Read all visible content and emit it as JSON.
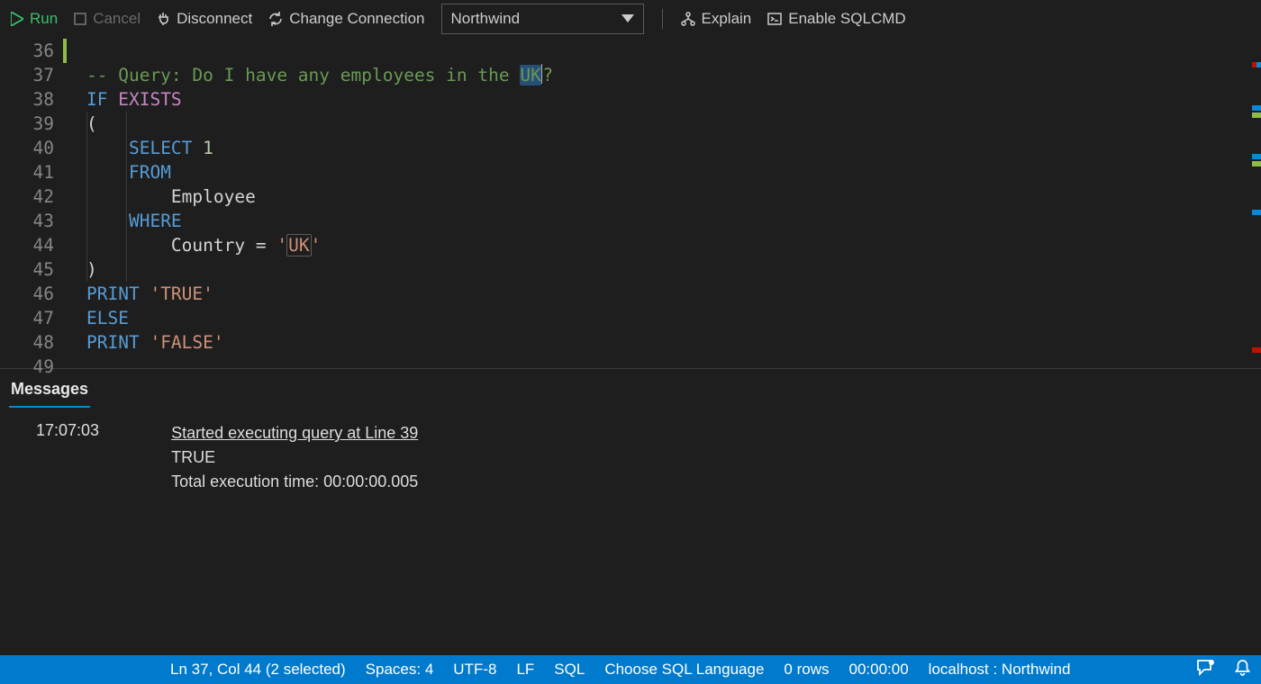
{
  "toolbar": {
    "run_label": "Run",
    "cancel_label": "Cancel",
    "disconnect_label": "Disconnect",
    "change_conn_label": "Change Connection",
    "db_selected": "Northwind",
    "explain_label": "Explain",
    "sqlcmd_label": "Enable SQLCMD"
  },
  "editor": {
    "first_line_no": 36,
    "lines": [
      {
        "n": 36,
        "tokens": []
      },
      {
        "n": 37,
        "tokens": [
          {
            "t": "-- Query: Do I have any employees in the ",
            "c": "tok-comment"
          },
          {
            "t": "UK",
            "c": "tok-comment selbox"
          },
          {
            "t": "?",
            "c": "tok-comment"
          }
        ]
      },
      {
        "n": 38,
        "tokens": [
          {
            "t": "IF",
            "c": "tok-kw"
          },
          {
            "t": " ",
            "c": ""
          },
          {
            "t": "EXISTS",
            "c": "tok-kw2"
          }
        ]
      },
      {
        "n": 39,
        "tokens": [
          {
            "t": "(",
            "c": "tok-ident"
          }
        ]
      },
      {
        "n": 40,
        "tokens": [
          {
            "t": "    ",
            "c": ""
          },
          {
            "t": "SELECT",
            "c": "tok-kw"
          },
          {
            "t": " ",
            "c": ""
          },
          {
            "t": "1",
            "c": "tok-num"
          }
        ]
      },
      {
        "n": 41,
        "tokens": [
          {
            "t": "    ",
            "c": ""
          },
          {
            "t": "FROM",
            "c": "tok-kw"
          }
        ]
      },
      {
        "n": 42,
        "tokens": [
          {
            "t": "        ",
            "c": ""
          },
          {
            "t": "Employee",
            "c": "tok-ident"
          }
        ]
      },
      {
        "n": 43,
        "tokens": [
          {
            "t": "    ",
            "c": ""
          },
          {
            "t": "WHERE",
            "c": "tok-kw"
          }
        ]
      },
      {
        "n": 44,
        "tokens": [
          {
            "t": "        ",
            "c": ""
          },
          {
            "t": "Country = ",
            "c": "tok-ident"
          },
          {
            "t": "'",
            "c": "tok-str"
          },
          {
            "t": "UK",
            "c": "tok-str matchbox"
          },
          {
            "t": "'",
            "c": "tok-str"
          }
        ]
      },
      {
        "n": 45,
        "tokens": [
          {
            "t": ")",
            "c": "tok-ident"
          }
        ]
      },
      {
        "n": 46,
        "tokens": [
          {
            "t": "PRINT",
            "c": "tok-kw"
          },
          {
            "t": " ",
            "c": ""
          },
          {
            "t": "'TRUE'",
            "c": "tok-str"
          }
        ]
      },
      {
        "n": 47,
        "tokens": [
          {
            "t": "ELSE",
            "c": "tok-kw"
          }
        ]
      },
      {
        "n": 48,
        "tokens": [
          {
            "t": "PRINT",
            "c": "tok-kw"
          },
          {
            "t": " ",
            "c": ""
          },
          {
            "t": "'FALSE'",
            "c": "tok-str"
          }
        ]
      },
      {
        "n": 49,
        "tokens": []
      }
    ]
  },
  "panel": {
    "tab_label": "Messages",
    "time": "17:07:03",
    "lines": [
      {
        "t": "Started executing query at Line 39",
        "u": true
      },
      {
        "t": "TRUE",
        "u": false
      },
      {
        "t": "Total execution time: 00:00:00.005",
        "u": false
      }
    ]
  },
  "status": {
    "cursor": "Ln 37, Col 44 (2 selected)",
    "spaces": "Spaces: 4",
    "encoding": "UTF-8",
    "eol": "LF",
    "lang": "SQL",
    "lang_choose": "Choose SQL Language",
    "rows": "0 rows",
    "exec_time": "00:00:00",
    "connection": "localhost : Northwind"
  }
}
